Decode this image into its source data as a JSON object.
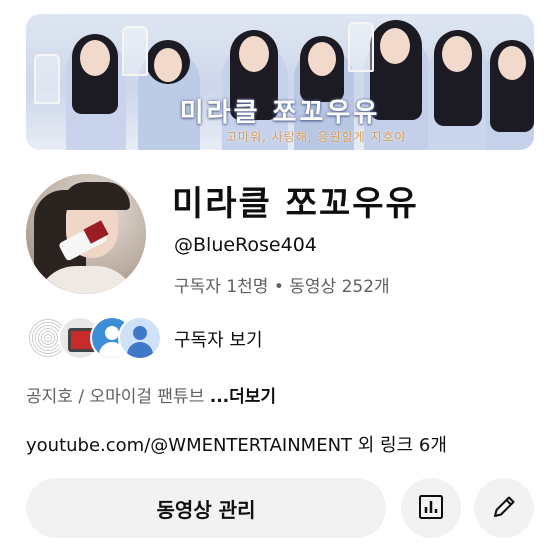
{
  "banner": {
    "title": "미라클 쪼꼬우유",
    "subtitle": "고마워, 사랑해, 응원할게 지호야"
  },
  "channel": {
    "name": "미라클 쪼꼬우유",
    "handle": "@BlueRose404",
    "stats": "구독자 1천명 • 동영상 252개"
  },
  "subscribers": {
    "label": "구독자 보기"
  },
  "description": {
    "text": "공지호 / 오마이걸 팬튜브 ",
    "more": "...더보기"
  },
  "links": {
    "text": "youtube.com/@WMENTERTAINMENT 외 링크 6개"
  },
  "actions": {
    "manage_label": "동영상 관리",
    "stats_icon": "analytics-icon",
    "edit_icon": "pencil-icon"
  }
}
